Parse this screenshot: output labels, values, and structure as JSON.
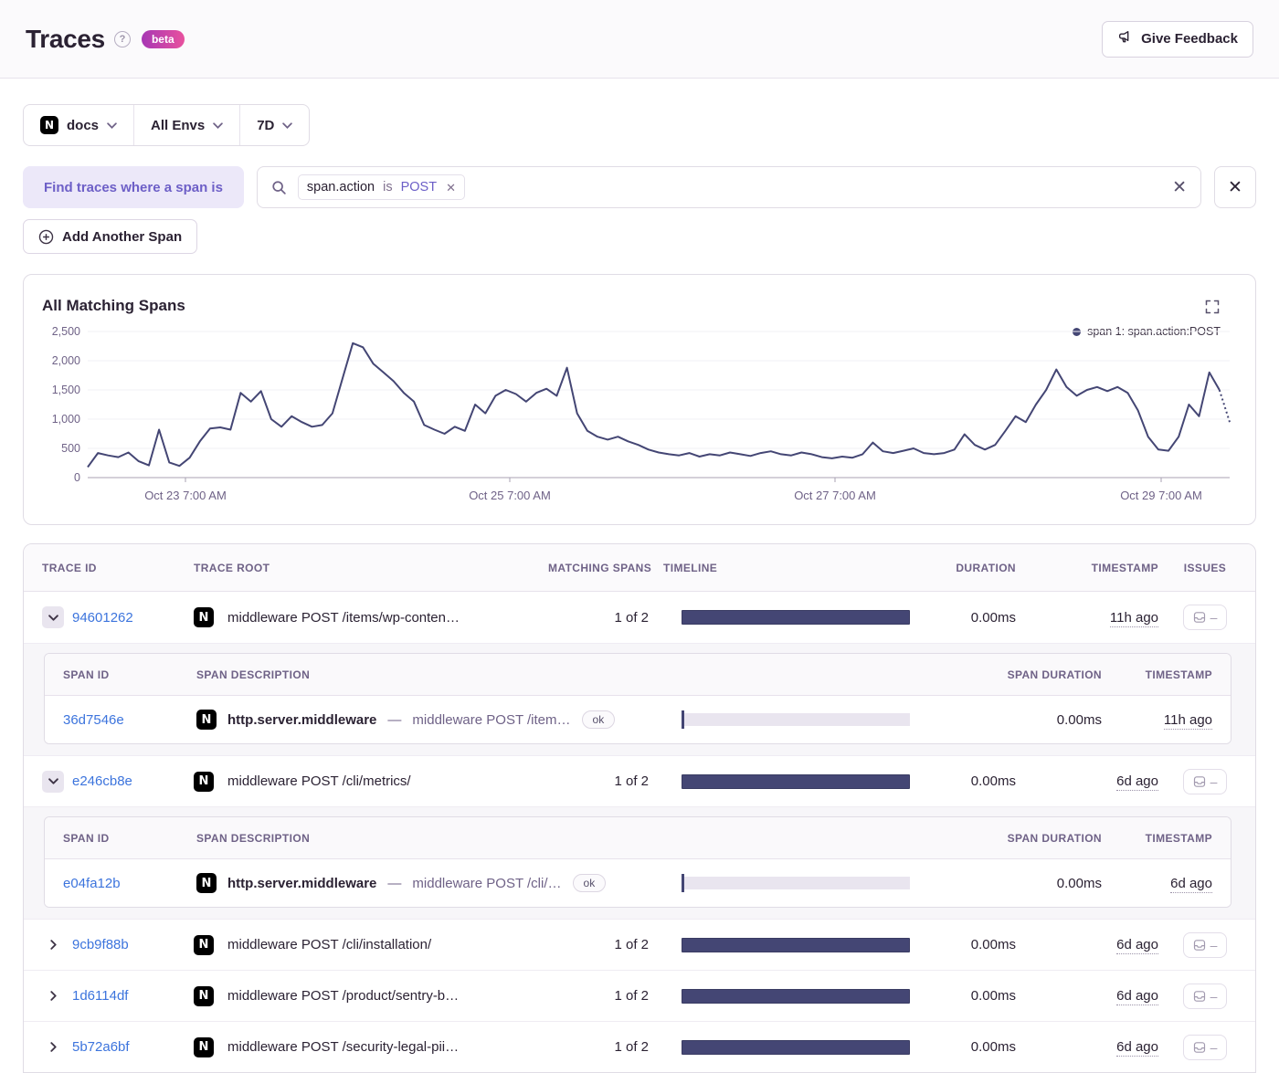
{
  "header": {
    "title": "Traces",
    "beta_label": "beta",
    "feedback_label": "Give Feedback"
  },
  "filters": {
    "project": "docs",
    "environment": "All Envs",
    "period": "7D"
  },
  "span_filter": {
    "label": "Find traces where a span is",
    "token_key": "span.action",
    "token_op": "is",
    "token_value": "POST",
    "add_button": "Add Another Span"
  },
  "chart_data": {
    "type": "line",
    "title": "All Matching Spans",
    "grid": true,
    "legend_position": "top-right",
    "line_color": "#444674",
    "ylim": [
      0,
      2500
    ],
    "y_ticks": [
      0,
      500,
      1000,
      1500,
      2000,
      2500
    ],
    "x_ticks": [
      {
        "label": "Oct 23 7:00 AM",
        "fraction": 0.0856
      },
      {
        "label": "Oct 25 7:00 AM",
        "fraction": 0.3696
      },
      {
        "label": "Oct 27 7:00 AM",
        "fraction": 0.6544
      },
      {
        "label": "Oct 29 7:00 AM",
        "fraction": 0.94
      }
    ],
    "dashed_tail_from_index": 111,
    "series": [
      {
        "name": "span 1: span.action:POST",
        "values": [
          180,
          420,
          380,
          350,
          430,
          280,
          210,
          820,
          260,
          200,
          340,
          620,
          840,
          860,
          820,
          1450,
          1300,
          1480,
          1000,
          870,
          1050,
          950,
          870,
          900,
          1100,
          1700,
          2300,
          2230,
          1950,
          1800,
          1650,
          1450,
          1300,
          900,
          820,
          750,
          870,
          800,
          1250,
          1100,
          1400,
          1500,
          1430,
          1300,
          1450,
          1520,
          1400,
          1880,
          1100,
          800,
          700,
          650,
          700,
          620,
          560,
          480,
          430,
          400,
          380,
          420,
          360,
          400,
          380,
          430,
          400,
          370,
          420,
          450,
          400,
          380,
          430,
          400,
          350,
          330,
          360,
          340,
          400,
          600,
          450,
          420,
          460,
          500,
          420,
          400,
          420,
          480,
          740,
          560,
          480,
          560,
          800,
          1050,
          950,
          1250,
          1500,
          1850,
          1550,
          1400,
          1500,
          1550,
          1480,
          1550,
          1450,
          1150,
          700,
          480,
          460,
          700,
          1250,
          1050,
          1800,
          1500,
          950
        ]
      }
    ]
  },
  "table": {
    "header": {
      "trace_id": "TRACE ID",
      "trace_root": "TRACE ROOT",
      "matching_spans": "MATCHING SPANS",
      "timeline": "TIMELINE",
      "duration": "DURATION",
      "timestamp": "TIMESTAMP",
      "issues": "ISSUES"
    },
    "span_header": {
      "span_id": "SPAN ID",
      "span_description": "SPAN DESCRIPTION",
      "span_duration": "SPAN DURATION",
      "timestamp": "TIMESTAMP"
    },
    "issues_empty": "–",
    "rows": [
      {
        "id": "94601262",
        "expanded": true,
        "root": "middleware POST /items/wp-conten…",
        "matching": "1 of 2",
        "duration": "0.00ms",
        "timestamp": "11h ago",
        "spans": [
          {
            "id": "36d7546e",
            "op": "http.server.middleware",
            "desc": "middleware POST /item…",
            "status": "ok",
            "duration": "0.00ms",
            "timestamp": "11h ago"
          }
        ]
      },
      {
        "id": "e246cb8e",
        "expanded": true,
        "root": "middleware POST /cli/metrics/",
        "matching": "1 of 2",
        "duration": "0.00ms",
        "timestamp": "6d ago",
        "spans": [
          {
            "id": "e04fa12b",
            "op": "http.server.middleware",
            "desc": "middleware POST /cli/…",
            "status": "ok",
            "duration": "0.00ms",
            "timestamp": "6d ago"
          }
        ]
      },
      {
        "id": "9cb9f88b",
        "expanded": false,
        "root": "middleware POST /cli/installation/",
        "matching": "1 of 2",
        "duration": "0.00ms",
        "timestamp": "6d ago",
        "spans": []
      },
      {
        "id": "1d6114df",
        "expanded": false,
        "root": "middleware POST /product/sentry-b…",
        "matching": "1 of 2",
        "duration": "0.00ms",
        "timestamp": "6d ago",
        "spans": []
      },
      {
        "id": "5b72a6bf",
        "expanded": false,
        "root": "middleware POST /security-legal-pii…",
        "matching": "1 of 2",
        "duration": "0.00ms",
        "timestamp": "6d ago",
        "spans": []
      }
    ]
  },
  "colors": {
    "accent_purple": "#6C5FC7",
    "link_blue": "#3C74DD",
    "chart_navy": "#444674",
    "border": "#E0DCE5"
  }
}
